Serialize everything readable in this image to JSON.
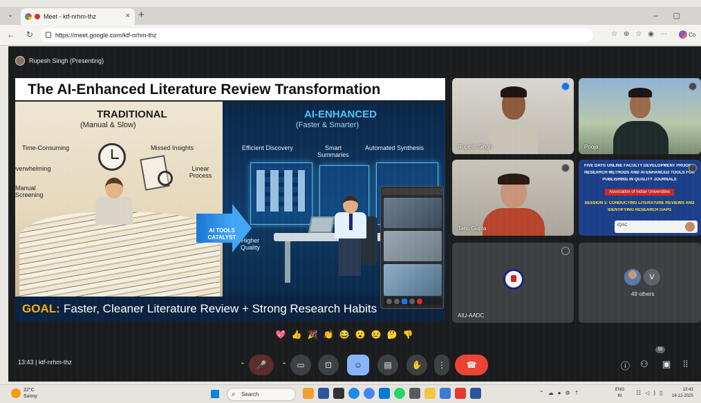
{
  "browser": {
    "tab_title": "Meet - ktf-nrhm-thz",
    "tab_close": "×",
    "new_tab": "+",
    "url": "https://meet.google.com/ktf-nrhm-thz",
    "copilot_label": "Co"
  },
  "meet": {
    "presenter": "Rupesh Singh (Presenting)",
    "time": "13:43",
    "code": "ktf-nrhm-thz",
    "participant_badge": "55"
  },
  "slide": {
    "title": "The AI-Enhanced Literature Review Transformation",
    "traditional_heading": "TRADITIONAL",
    "traditional_sub": "(Manual & Slow)",
    "traditional_points": [
      "Time-Consuming",
      "Missed Insights",
      "Overwhelming",
      "Linear Process",
      "Manual Screening"
    ],
    "ai_heading": "AI-ENHANCED",
    "ai_sub": "(Faster & Smarter)",
    "ai_points": [
      "Efficient Discovery",
      "Smart Summaries",
      "Automated Synthesis",
      "Higher Quality"
    ],
    "catalyst": "AI TOOLS CATALYST",
    "goal_label": "GOAL:",
    "goal_text": "Faster, Cleaner Literature Review + Strong Research Habits"
  },
  "participants": [
    {
      "name": "Rupesh Singh",
      "speaking": true
    },
    {
      "name": "Pooja",
      "speaking": false
    },
    {
      "name": "Tanu Gupta",
      "speaking": false
    },
    {
      "name": "IQAC",
      "speaking": false
    },
    {
      "name": "AIU-AADC",
      "speaking": false
    },
    {
      "name": "49 others",
      "initial": "V"
    }
  ],
  "screen_share_tile": {
    "lines": [
      "FIVE DAYS ONLINE FACULTY DEVELOPMENT PROGRAMME",
      "RESEARCH METHODS AND AI-ENHANCED TOOLS FOR",
      "PUBLISHING IN QUALITY JOURNALS",
      "Association of Indian Universities",
      "SESSION 1: CONDUCTING LITERATURE REVIEWS AND",
      "IDENTIFYING RESEARCH GAPS"
    ]
  },
  "reactions": [
    "💖",
    "👍",
    "🎉",
    "👏",
    "😂",
    "😮",
    "😢",
    "🤔",
    "👎"
  ],
  "taskbar": {
    "temperature": "22°C",
    "weather": "Sunny",
    "search_placeholder": "Search",
    "lang_top": "ENG",
    "lang_bottom": "IN",
    "time": "13:43",
    "date": "16-12-2025"
  },
  "colors": {
    "end_call": "#ea4335",
    "accent": "#8ab4f8",
    "goal_label": "#ffb300"
  }
}
